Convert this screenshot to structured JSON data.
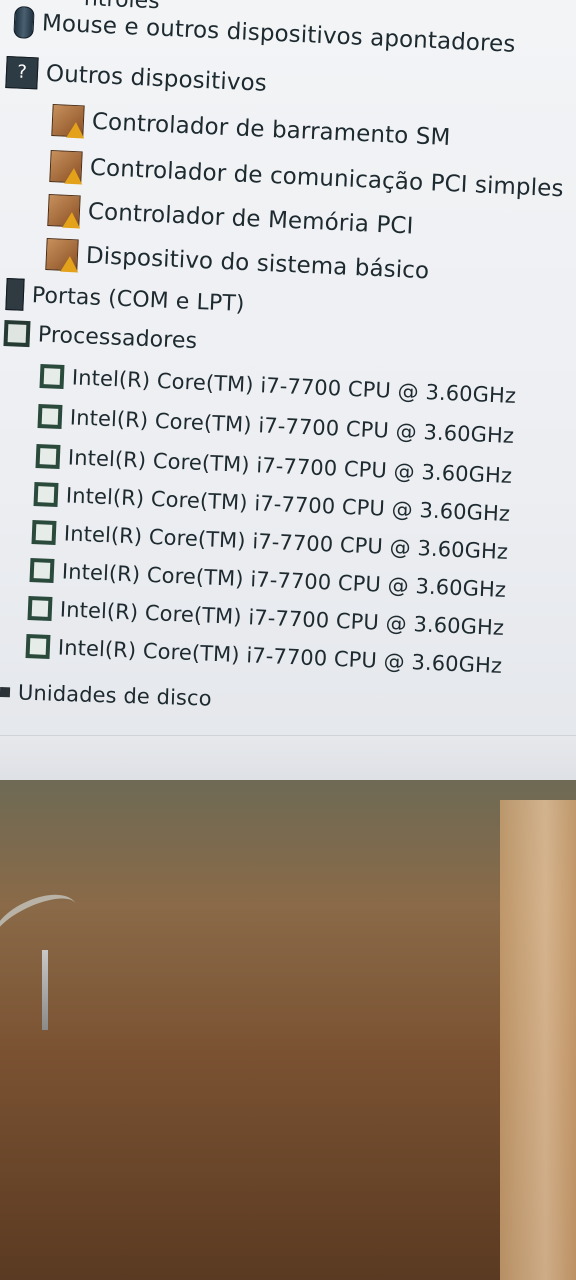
{
  "device_manager": {
    "clipped_category": "ntroles",
    "tree": [
      {
        "label": "Mouse e outros dispositivos apontadores",
        "level": 0,
        "icon": "mouse-icon"
      },
      {
        "label": "Outros dispositivos",
        "level": 0,
        "icon": "unknown-device-icon"
      },
      {
        "label": "Controlador de barramento SM",
        "level": 1,
        "icon": "warning-device-icon"
      },
      {
        "label": "Controlador de comunicação PCI simples",
        "level": 1,
        "icon": "warning-device-icon"
      },
      {
        "label": "Controlador de Memória PCI",
        "level": 1,
        "icon": "warning-device-icon"
      },
      {
        "label": "Dispositivo do sistema básico",
        "level": 1,
        "icon": "warning-device-icon"
      },
      {
        "label": "Portas (COM e LPT)",
        "level": 0,
        "icon": "port-icon"
      },
      {
        "label": "Processadores",
        "level": 0,
        "icon": "processor-icon"
      },
      {
        "label": "Intel(R) Core(TM) i7-7700 CPU @ 3.60GHz",
        "level": 1,
        "icon": "processor-icon"
      },
      {
        "label": "Intel(R) Core(TM) i7-7700 CPU @ 3.60GHz",
        "level": 1,
        "icon": "processor-icon"
      },
      {
        "label": "Intel(R) Core(TM) i7-7700 CPU @ 3.60GHz",
        "level": 1,
        "icon": "processor-icon"
      },
      {
        "label": "Intel(R) Core(TM) i7-7700 CPU @ 3.60GHz",
        "level": 1,
        "icon": "processor-icon"
      },
      {
        "label": "Intel(R) Core(TM) i7-7700 CPU @ 3.60GHz",
        "level": 1,
        "icon": "processor-icon"
      },
      {
        "label": "Intel(R) Core(TM) i7-7700 CPU @ 3.60GHz",
        "level": 1,
        "icon": "processor-icon"
      },
      {
        "label": "Intel(R) Core(TM) i7-7700 CPU @ 3.60GHz",
        "level": 1,
        "icon": "processor-icon"
      },
      {
        "label": "Intel(R) Core(TM) i7-7700 CPU @ 3.60GHz",
        "level": 1,
        "icon": "processor-icon"
      },
      {
        "label": "Unidades de disco",
        "level": 0,
        "icon": "disk-drive-icon"
      }
    ]
  },
  "colors": {
    "window_background": "#eceef2",
    "text": "#1d2a30",
    "warning": "#e3a21a",
    "processor_icon": "#243a33"
  }
}
